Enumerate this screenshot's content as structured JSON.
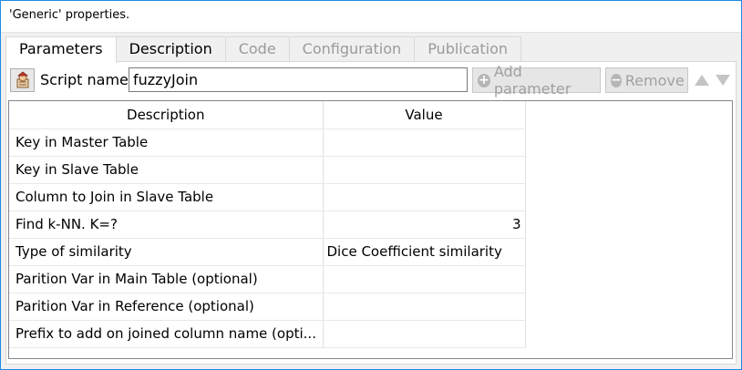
{
  "window": {
    "title": "'Generic' properties."
  },
  "tabs": [
    {
      "label": "Parameters",
      "state": "active"
    },
    {
      "label": "Description",
      "state": "normal"
    },
    {
      "label": "Code",
      "state": "disabled"
    },
    {
      "label": "Configuration",
      "state": "disabled"
    },
    {
      "label": "Publication",
      "state": "disabled"
    }
  ],
  "toolbar": {
    "icon": "script-person-icon",
    "script_label": "Script name:",
    "script_value": "fuzzyJoin",
    "add_label": "Add parameter",
    "remove_label": "Remove",
    "up_icon": "arrow-up-icon",
    "down_icon": "arrow-down-icon"
  },
  "table": {
    "headers": [
      "Description",
      "Value"
    ],
    "rows": [
      {
        "description": "Key in Master Table",
        "value": ""
      },
      {
        "description": "Key in Slave Table",
        "value": ""
      },
      {
        "description": "Column to Join in Slave Table",
        "value": ""
      },
      {
        "description": "Find k-NN. K=?",
        "value": "3"
      },
      {
        "description": "Type of similarity",
        "value": "Dice Coefficient similarity"
      },
      {
        "description": "Parition Var in Main Table (optional)",
        "value": ""
      },
      {
        "description": "Parition Var in Reference (optional)",
        "value": ""
      },
      {
        "description": "Prefix to add on joined column name (opti...",
        "value": ""
      }
    ]
  },
  "colors": {
    "frame_border": "#1e8ae6",
    "panel_bg": "#f0f0f0",
    "disabled_text": "#9a9a9a"
  }
}
